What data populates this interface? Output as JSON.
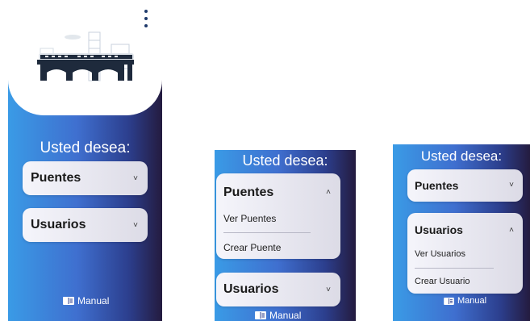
{
  "menu_icon": "kebab-menu-icon",
  "header_image": "bridge-train-illustration",
  "colors": {
    "accent": "#3f6fcf",
    "dark": "#241b3f",
    "text": "#1a1a1a"
  },
  "title": "Usted desea:",
  "screen1": {
    "puentes": {
      "label": "Puentes",
      "chevron": "˅"
    },
    "usuarios": {
      "label": "Usuarios",
      "chevron": "˅"
    },
    "manual": "Manual"
  },
  "screen2": {
    "puentes": {
      "label": "Puentes",
      "chevron": "˄",
      "options": [
        "Ver Puentes",
        "Crear Puente"
      ]
    },
    "usuarios": {
      "label": "Usuarios",
      "chevron": "˅"
    },
    "manual": "Manual"
  },
  "screen3": {
    "puentes": {
      "label": "Puentes",
      "chevron": "˅"
    },
    "usuarios": {
      "label": "Usuarios",
      "chevron": "˄",
      "options": [
        "Ver Usuarios",
        "Crear Usuario"
      ]
    },
    "manual": "Manual"
  }
}
